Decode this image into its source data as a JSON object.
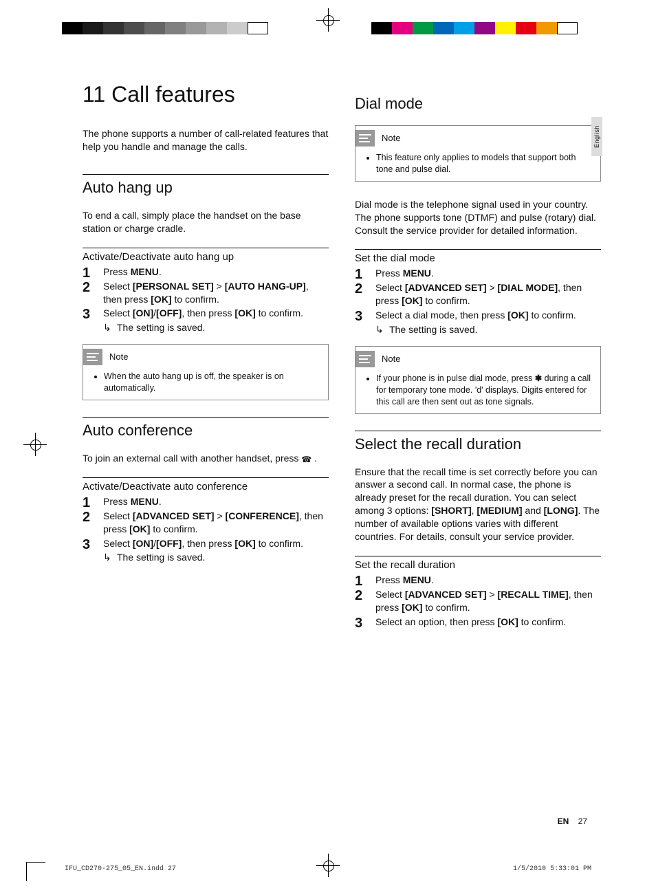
{
  "chapter": {
    "num": "11",
    "title": "Call features"
  },
  "intro": "The phone supports a number of call-related features that help you handle and manage the calls.",
  "lang_tab": "English",
  "sections": {
    "auto_hangup": {
      "title": "Auto hang up",
      "body": "To end a call, simply place the handset on the base station or charge cradle.",
      "sub_title": "Activate/Deactivate auto hang up",
      "steps": {
        "s1_a": "Press ",
        "s1_b": "MENU",
        "s1_c": ".",
        "s2_a": "Select ",
        "s2_b": "[PERSONAL SET]",
        "s2_c": " > ",
        "s2_d": "[AUTO HANG-UP]",
        "s2_e": ", then press ",
        "s2_f": "[OK]",
        "s2_g": " to confirm.",
        "s3_a": "Select ",
        "s3_b": "[ON]",
        "s3_c": "/",
        "s3_d": "[OFF]",
        "s3_e": ", then press ",
        "s3_f": "[OK]",
        "s3_g": " to confirm.",
        "result": "The setting is saved."
      },
      "note_title": "Note",
      "note_body": "When the auto hang up is off, the speaker is on automatically."
    },
    "auto_conf": {
      "title": "Auto conference",
      "body_a": "To join an external call with another handset, press ",
      "body_b": " .",
      "sub_title": "Activate/Deactivate auto conference",
      "steps": {
        "s1_a": "Press ",
        "s1_b": "MENU",
        "s1_c": ".",
        "s2_a": "Select ",
        "s2_b": "[ADVANCED SET]",
        "s2_c": " > ",
        "s2_d": "[CONFERENCE]",
        "s2_e": ", then press ",
        "s2_f": "[OK]",
        "s2_g": " to confirm.",
        "s3_a": "Select ",
        "s3_b": "[ON]",
        "s3_c": "/",
        "s3_d": "[OFF]",
        "s3_e": ", then press ",
        "s3_f": "[OK]",
        "s3_g": " to confirm.",
        "result": "The setting is saved."
      }
    },
    "dial_mode": {
      "title": "Dial mode",
      "note1_title": "Note",
      "note1_body": "This feature only applies to models that support both tone and pulse dial.",
      "body": "Dial mode is the telephone signal used in your country. The phone supports tone (DTMF) and pulse (rotary) dial. Consult the service provider for detailed information.",
      "sub_title": "Set the dial mode",
      "steps": {
        "s1_a": "Press ",
        "s1_b": "MENU",
        "s1_c": ".",
        "s2_a": "Select ",
        "s2_b": "[ADVANCED SET]",
        "s2_c": " > ",
        "s2_d": "[DIAL MODE]",
        "s2_e": ", then press ",
        "s2_f": "[OK]",
        "s2_g": " to confirm.",
        "s3_a": "Select a dial mode, then press ",
        "s3_b": "[OK]",
        "s3_c": " to confirm.",
        "result": "The setting is saved."
      },
      "note2_title": "Note",
      "note2_body_a": "If your phone is in pulse dial mode, press ",
      "note2_body_b": " during a call for temporary tone mode. 'd' displays. Digits entered for this call are then sent out as tone signals."
    },
    "recall": {
      "title": "Select the recall duration",
      "body_a": "Ensure that the recall time is set correctly before you can answer a second call. In normal case, the phone is already preset for the recall duration. You can select among 3 options: ",
      "body_b": "[SHORT]",
      "body_c": ", ",
      "body_d": "[MEDIUM]",
      "body_e": " and ",
      "body_f": "[LONG]",
      "body_g": ". The number of available options varies with different countries. For details, consult your service provider.",
      "sub_title": "Set the recall duration",
      "steps": {
        "s1_a": "Press ",
        "s1_b": "MENU",
        "s1_c": ".",
        "s2_a": "Select ",
        "s2_b": "[ADVANCED SET]",
        "s2_c": " > ",
        "s2_d": "[RECALL TIME]",
        "s2_e": ", then press ",
        "s2_f": "[OK]",
        "s2_g": " to confirm.",
        "s3_a": "Select an option, then press ",
        "s3_b": "[OK]",
        "s3_c": " to confirm."
      }
    }
  },
  "footer": {
    "lang": "EN",
    "page": "27"
  },
  "print": {
    "file": "IFU_CD270-275_05_EN.indd   27",
    "stamp": "1/5/2010   5:33:01 PM"
  },
  "swatches_left": [
    "#000000",
    "#1a1a1a",
    "#333333",
    "#4d4d4d",
    "#666666",
    "#808080",
    "#999999",
    "#b3b3b3",
    "#cccccc",
    "#ffffff"
  ],
  "swatches_right": [
    "#000000",
    "#e4007f",
    "#009944",
    "#0068b7",
    "#00a0e9",
    "#920783",
    "#fff100",
    "#e60012",
    "#f39800",
    "#ffffff"
  ]
}
